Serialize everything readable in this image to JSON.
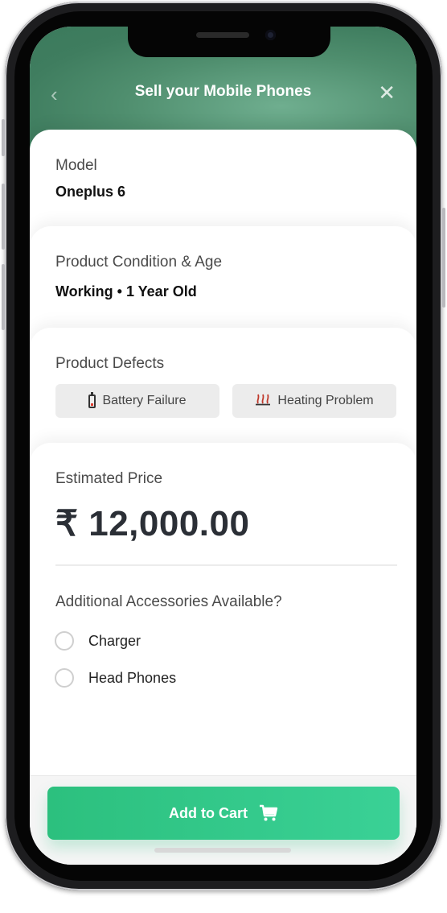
{
  "header": {
    "title": "Sell your Mobile Phones",
    "back_icon": "‹",
    "close_icon": "✕"
  },
  "model": {
    "label": "Model",
    "value": "Oneplus 6"
  },
  "condition": {
    "label": "Product Condition & Age",
    "value": "Working • 1 Year Old"
  },
  "defects": {
    "label": "Product Defects",
    "items": [
      {
        "icon": "battery-icon",
        "label": "Battery Failure"
      },
      {
        "icon": "heat-icon",
        "label": "Heating Problem"
      }
    ]
  },
  "price": {
    "label": "Estimated Price",
    "value": "₹ 12,000.00"
  },
  "accessories": {
    "label": "Additional Accessories Available?",
    "options": [
      {
        "label": "Charger",
        "checked": false
      },
      {
        "label": "Head Phones",
        "checked": false
      }
    ]
  },
  "cart": {
    "label": "Add to Cart",
    "icon": "cart-icon"
  },
  "colors": {
    "accent": "#2cc07e",
    "header_bg": "#4f8e6e",
    "text": "#111111"
  }
}
